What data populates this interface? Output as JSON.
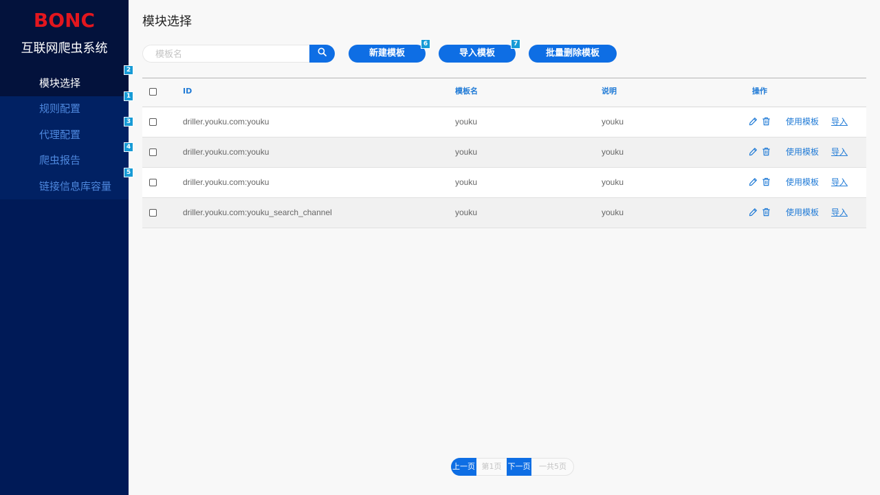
{
  "sidebar": {
    "logo_text": "BONC",
    "app_title": "互联网爬虫系统",
    "items": [
      {
        "label": "模块选择",
        "active": true,
        "marker": "2"
      },
      {
        "label": "规则配置",
        "active": false,
        "marker": "1"
      },
      {
        "label": "代理配置",
        "active": false,
        "marker": "3"
      },
      {
        "label": "爬虫报告",
        "active": false,
        "marker": "4"
      },
      {
        "label": "链接信息库容量",
        "active": false,
        "marker": "5"
      }
    ]
  },
  "main": {
    "page_title": "模块选择",
    "search": {
      "placeholder": "模板名",
      "button_icon": "search-icon"
    },
    "toolbar": {
      "new_template": {
        "label": "新建模板",
        "marker": "6"
      },
      "import_template": {
        "label": "导入模板",
        "marker": "7"
      },
      "batch_delete": {
        "label": "批量删除模板"
      }
    }
  },
  "table": {
    "columns": [
      "ID",
      "模板名",
      "说明",
      "操作"
    ],
    "rows": [
      {
        "id": "driller.youku.com:youku",
        "name": "youku",
        "description": "youku"
      },
      {
        "id": "driller.youku.com:youku",
        "name": "youku",
        "description": "youku"
      },
      {
        "id": "driller.youku.com:youku",
        "name": "youku",
        "description": "youku"
      },
      {
        "id": "driller.youku.com:youku_search_channel",
        "name": "youku",
        "description": "youku"
      }
    ],
    "row_actions": {
      "edit_icon": "pencil-icon",
      "delete_icon": "trash-icon",
      "use_label": "使用模板",
      "import_label": "导入"
    }
  },
  "pagination": {
    "prev_label": "上一页",
    "current_page": "第1页",
    "next_label": "下一页",
    "total_pages": "一共5页"
  },
  "colors": {
    "accent": "#0e6ee4",
    "logo": "#e3161e",
    "sidebar": "#001a57",
    "sidebar_active": "#03123c",
    "sidebar_item": "#012163",
    "marker": "#179bd6",
    "link": "#1f7ad6",
    "page_background": "#f8f8f8"
  }
}
